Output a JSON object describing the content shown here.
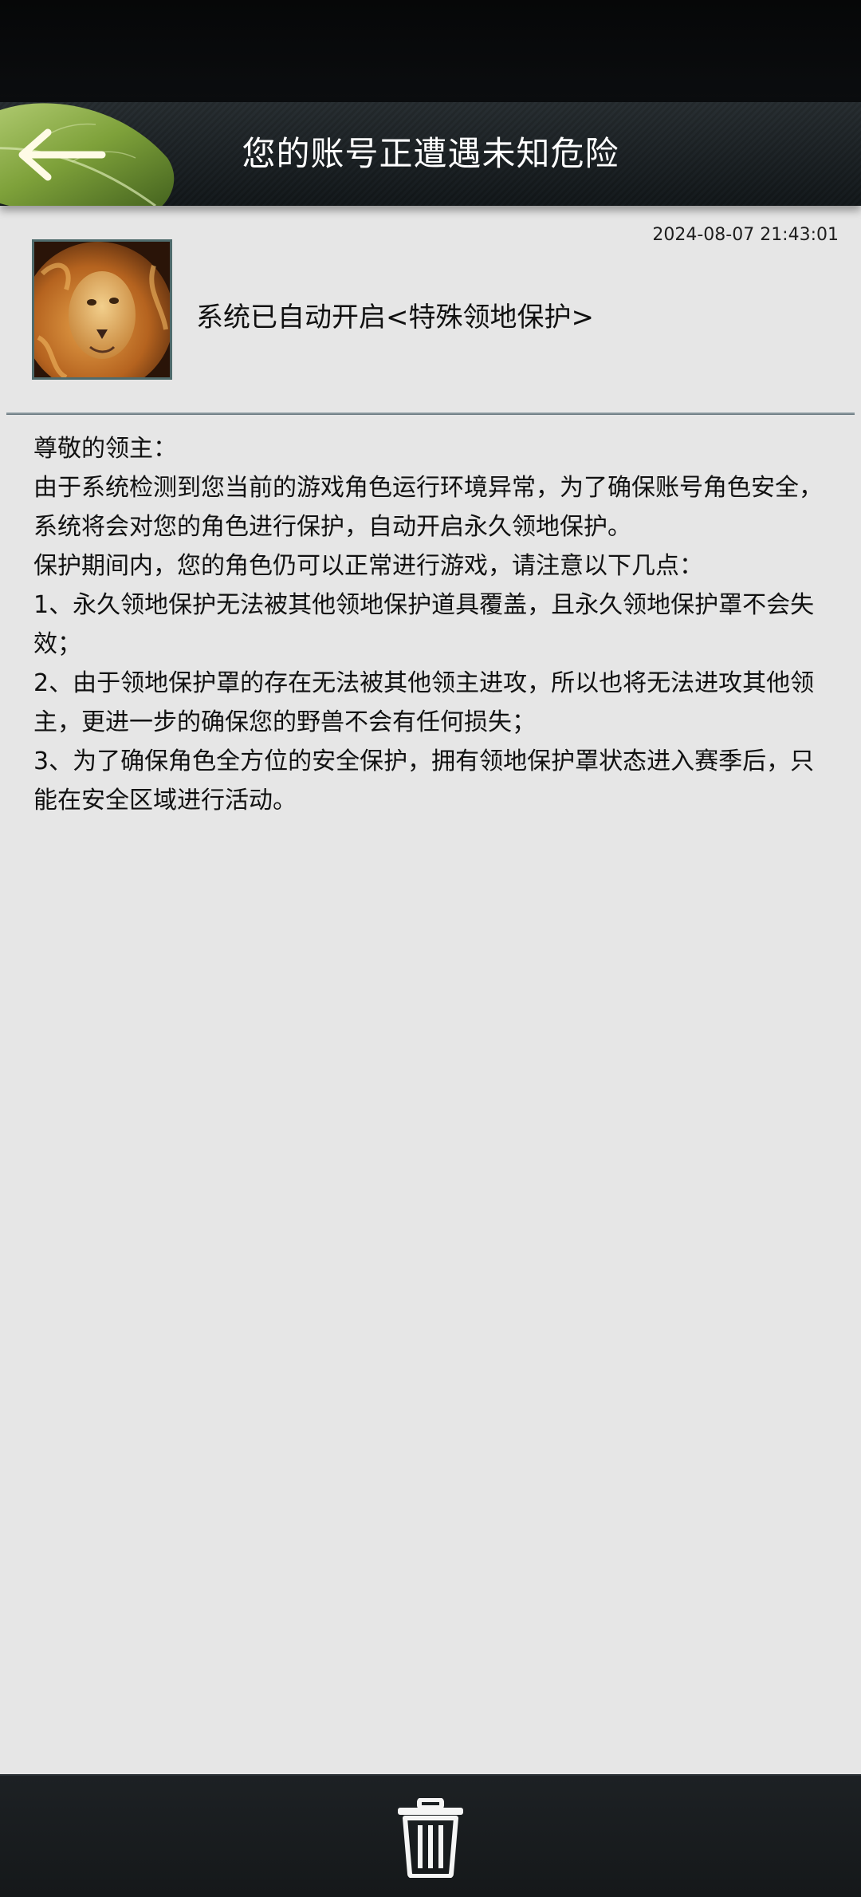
{
  "header": {
    "title": "您的账号正遭遇未知危险",
    "back_icon": "back-arrow-icon"
  },
  "message": {
    "timestamp": "2024-08-07 21:43:01",
    "sender_avatar": "lion-avatar",
    "subject": "系统已自动开启<特殊领地保护>",
    "paragraphs": [
      "尊敬的领主：",
      "由于系统检测到您当前的游戏角色运行环境异常，为了确保账号角色安全，系统将会对您的角色进行保护，自动开启永久领地保护。",
      "保护期间内，您的角色仍可以正常进行游戏，请注意以下几点：",
      "1、永久领地保护无法被其他领地保护道具覆盖，且永久领地保护罩不会失效；",
      "2、由于领地保护罩的存在无法被其他领主进攻，所以也将无法进攻其他领主，更进一步的确保您的野兽不会有任何损失；",
      "3、为了确保角色全方位的安全保护，拥有领地保护罩状态进入赛季后，只能在安全区域进行活动。"
    ]
  },
  "footer": {
    "delete_icon": "trash-icon"
  },
  "colors": {
    "background": "#e6e6e6",
    "header": "#1b2226",
    "accent_leaf": "#6f9a2f",
    "text": "#111111"
  }
}
